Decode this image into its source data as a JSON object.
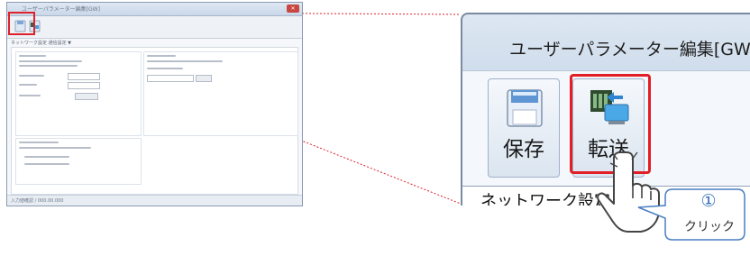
{
  "mini_window": {
    "title": "ユーザーパラメーター編集[GW]",
    "close_label": "✕",
    "tab_label": "ネットワーク設定  通信設定  ▼",
    "status_text": "入力値確認 / 000.00.000"
  },
  "zoom_window": {
    "title": "ユーザーパラメーター編集[GW",
    "save_label": "保存",
    "transfer_label": "転送",
    "bottom_tab_label": "ネットワーク設定"
  },
  "callout": {
    "step_number": "①",
    "action_label": "クリック"
  },
  "colors": {
    "highlight": "#e21f26",
    "callout_border": "#4a7fc1"
  }
}
